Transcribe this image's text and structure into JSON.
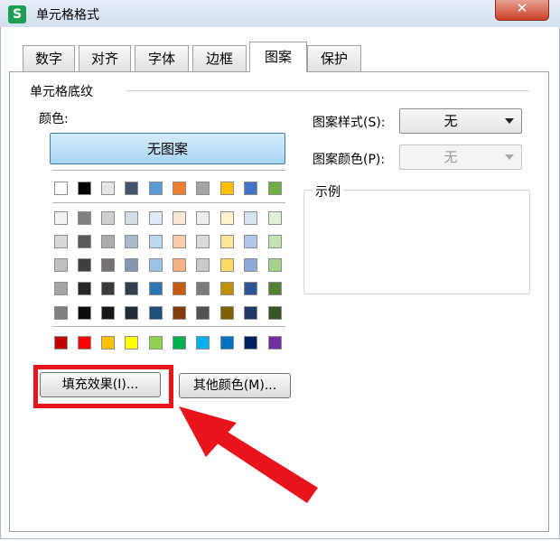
{
  "window": {
    "title": "单元格格式",
    "app_icon_glyph": "S",
    "close_glyph": "✕"
  },
  "tabs": [
    {
      "label": "数字"
    },
    {
      "label": "对齐"
    },
    {
      "label": "字体"
    },
    {
      "label": "边框"
    },
    {
      "label": "图案",
      "active": true
    },
    {
      "label": "保护"
    }
  ],
  "panel": {
    "group_title": "单元格底纹",
    "color_label": "颜色:",
    "no_pattern_button": "无图案",
    "palette": {
      "theme_row": [
        "#ffffff",
        "#000000",
        "#e7e6e6",
        "#44546a",
        "#5b9bd5",
        "#ed7d31",
        "#a5a5a5",
        "#ffc000",
        "#4472c4",
        "#70ad47"
      ],
      "shade_rows": [
        [
          "#f2f2f2",
          "#7f7f7f",
          "#d0cece",
          "#d6dce4",
          "#deebf6",
          "#fbe5d5",
          "#ededed",
          "#fff2cc",
          "#d9e2f3",
          "#e2efd9"
        ],
        [
          "#d8d8d8",
          "#595959",
          "#aeabab",
          "#adb9ca",
          "#bdd7ee",
          "#f7cbac",
          "#dbdbdb",
          "#fee599",
          "#b4c6e7",
          "#c5e0b3"
        ],
        [
          "#bfbfbf",
          "#3f3f3f",
          "#757070",
          "#8496b0",
          "#9cc3e5",
          "#f4b183",
          "#c9c9c9",
          "#ffd965",
          "#8eaadb",
          "#a8d08d"
        ],
        [
          "#a5a5a5",
          "#262626",
          "#3a3838",
          "#323f4f",
          "#2e75b5",
          "#c55a11",
          "#7b7b7b",
          "#bf9000",
          "#2f5496",
          "#538135"
        ],
        [
          "#7f7f7f",
          "#0c0c0c",
          "#171616",
          "#222a35",
          "#1e4e79",
          "#833c0b",
          "#525252",
          "#7f6000",
          "#1f3864",
          "#375623"
        ]
      ],
      "standard_row": [
        "#c00000",
        "#ff0000",
        "#ffc000",
        "#ffff00",
        "#92d050",
        "#00b050",
        "#00b0f0",
        "#0070c0",
        "#002060",
        "#7030a0"
      ]
    },
    "fill_effects_button": "填充效果(I)...",
    "more_colors_button": "其他颜色(M)...",
    "pattern_style_label": "图案样式(S):",
    "pattern_style_value": "无",
    "pattern_color_label": "图案颜色(P):",
    "pattern_color_value": "无",
    "example_label": "示例"
  },
  "annotation": {
    "highlight_color": "#e8141c"
  }
}
